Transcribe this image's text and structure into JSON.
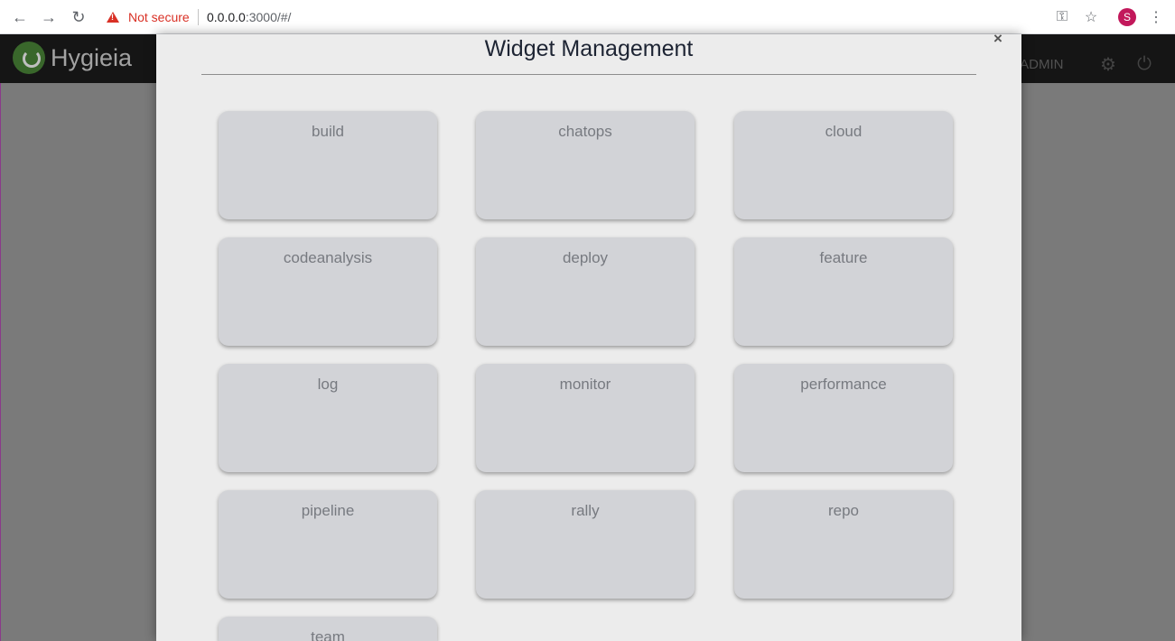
{
  "browser": {
    "security_text": "Not secure",
    "url_host": "0.0.0.0",
    "url_rest": ":3000/#/",
    "profile_initial": "S"
  },
  "app": {
    "logo_text": "Hygieia",
    "welcome_text": "me ADMIN"
  },
  "modal": {
    "title": "Widget Management",
    "close_label": "×",
    "widgets": [
      "build",
      "chatops",
      "cloud",
      "codeanalysis",
      "deploy",
      "feature",
      "log",
      "monitor",
      "performance",
      "pipeline",
      "rally",
      "repo",
      "team"
    ]
  },
  "icons": {
    "back": "arrow-left-icon",
    "forward": "arrow-right-icon",
    "reload": "reload-icon",
    "warning": "warning-icon",
    "key": "key-icon",
    "star": "star-icon",
    "menu": "kebab-menu-icon",
    "gear": "gear-icon",
    "power": "power-icon"
  },
  "colors": {
    "modal_bg": "#ececec",
    "card_bg": "#d2d3d7",
    "card_text": "#777a80",
    "title": "#1d2433",
    "insecure": "#d93025",
    "logo_green": "#4c8a3a"
  }
}
